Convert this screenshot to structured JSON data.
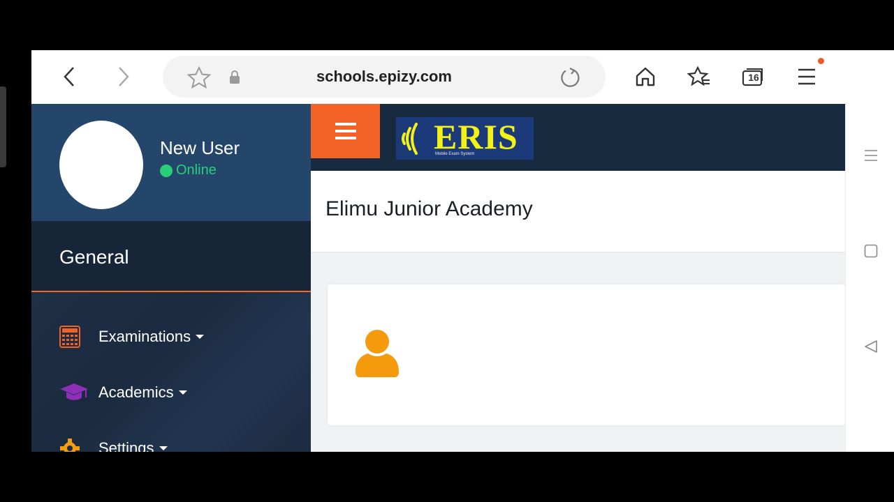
{
  "browser": {
    "url": "schools.epizy.com",
    "tab_count": "16"
  },
  "sidebar": {
    "user_name": "New User",
    "status": "Online",
    "section_title": "General",
    "items": [
      {
        "label": "Examinations",
        "icon": "calculator-icon",
        "color": "#f36227"
      },
      {
        "label": "Academics",
        "icon": "graduation-cap-icon",
        "color": "#8e2fb8"
      },
      {
        "label": "Settings",
        "icon": "gear-icon",
        "color": "#f39c12"
      }
    ]
  },
  "header": {
    "logo_text": "ERIS",
    "logo_tagline": "Mobile Exam System"
  },
  "main": {
    "school_name": "Elimu Junior Academy"
  },
  "colors": {
    "accent": "#f36227",
    "sidebar": "#1d2c42",
    "online": "#28d07a",
    "user_icon": "#f59a0c"
  }
}
